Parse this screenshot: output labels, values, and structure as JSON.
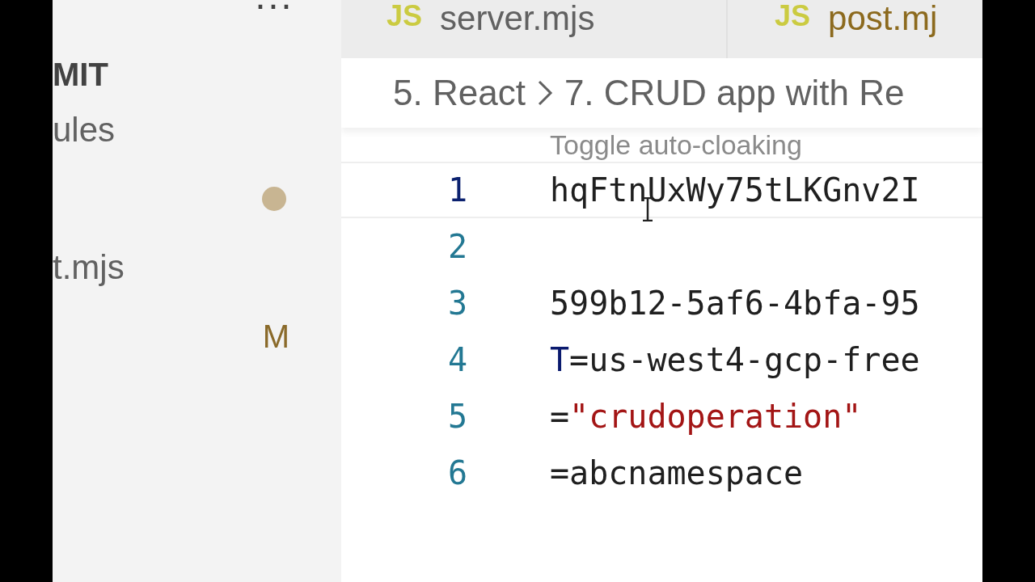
{
  "tabs": [
    {
      "icon": "JS",
      "label": "server.mjs",
      "modified": false
    },
    {
      "icon": "JS",
      "label": "post.mj",
      "modified": true
    }
  ],
  "sidebar": {
    "more": "···",
    "section_title": "MIT",
    "items": [
      {
        "kind": "file",
        "label": "ules"
      },
      {
        "kind": "dot",
        "color": "#c8b592"
      },
      {
        "kind": "file",
        "label": "t.mjs"
      },
      {
        "kind": "badge",
        "badge": "M"
      }
    ]
  },
  "breadcrumb": [
    "5. React",
    "7. CRUD app with Re"
  ],
  "hint": "Toggle auto-cloaking",
  "lines": [
    {
      "number": "1",
      "current": true,
      "tokens": [
        {
          "kind": "plain",
          "text": "hqFtnUxWy75tLKGnv2I"
        }
      ]
    },
    {
      "number": "2",
      "current": false
    },
    {
      "number": "3",
      "current": false,
      "tokens": [
        {
          "kind": "plain",
          "text": "599b12-5af6-4bfa-95"
        }
      ]
    },
    {
      "number": "4",
      "current": false,
      "tokens": [
        {
          "kind": "variable",
          "text": "T"
        },
        {
          "kind": "plain",
          "text": "=us-west4-gcp-free"
        }
      ]
    },
    {
      "number": "5",
      "current": false,
      "tokens": [
        {
          "kind": "plain",
          "text": "="
        },
        {
          "kind": "string",
          "text": "\"crudoperation\""
        }
      ]
    },
    {
      "number": "6",
      "current": false,
      "tokens": [
        {
          "kind": "plain",
          "text": "=abcnamespace"
        }
      ]
    }
  ]
}
